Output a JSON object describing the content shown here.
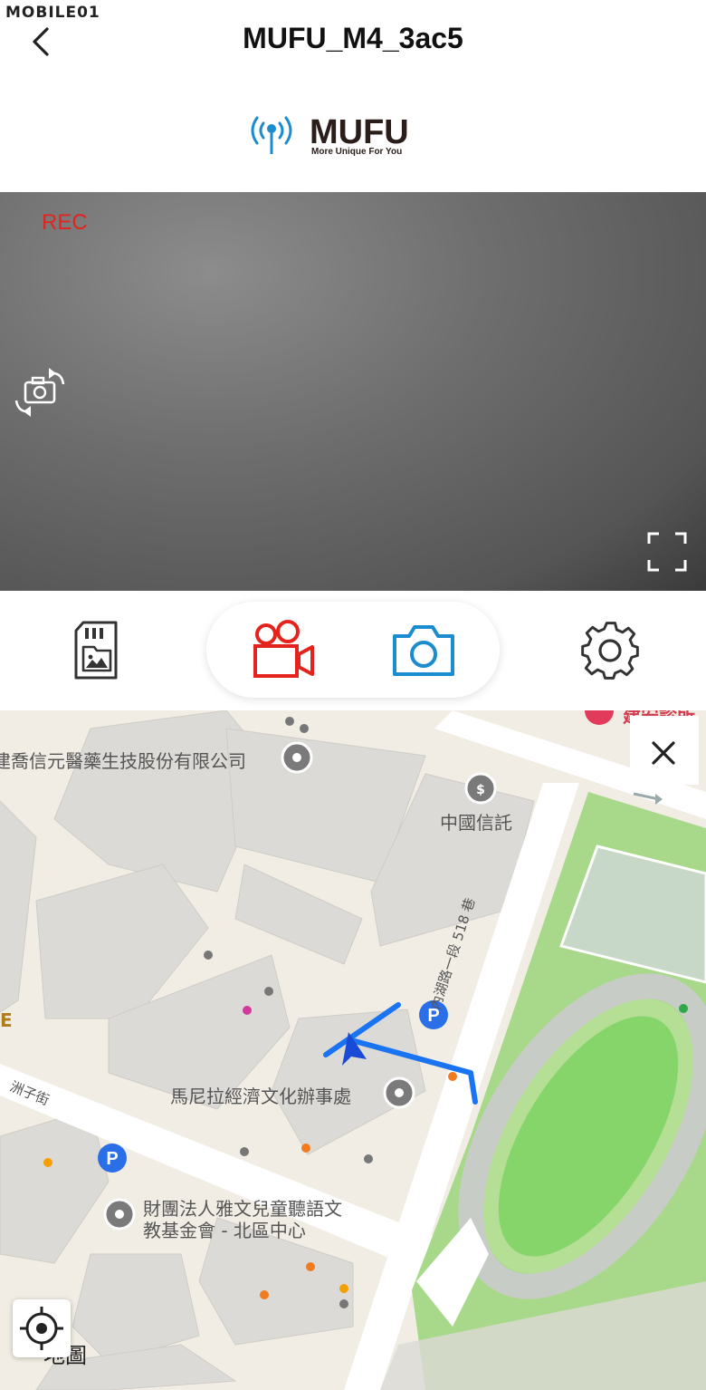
{
  "watermark": "MOBILE01",
  "header": {
    "title": "MUFU_M4_3ac5",
    "back_icon": "chevron-left-icon"
  },
  "logo": {
    "brand": "MUFU",
    "tagline": "More Unique For You",
    "brand_color": "#1a8ccf"
  },
  "camera": {
    "rec_label": "REC",
    "rec_color": "#e4231f"
  },
  "controls": {
    "sd_icon": "sd-card-gallery-icon",
    "video_icon": "video-camera-icon",
    "photo_icon": "camera-icon",
    "settings_icon": "gear-icon",
    "video_color": "#e4231f",
    "photo_color": "#1a8ccf"
  },
  "map": {
    "labels": {
      "company": "建喬信元醫藥生技股份有限公司",
      "bank": "中國信託",
      "office": "馬尼拉經濟文化辦事處",
      "foundation_line1": "財團法人雅文兒童聽語文",
      "foundation_line2": "教基金會 - 北區中心",
      "road": "內湖路一段 518 巷",
      "street": "洲子街",
      "clinic": "建安診所",
      "edge_letter": "E",
      "maps_brand": "地圖"
    },
    "route_color": "#1a73f0",
    "park_color": "#a8d98a"
  }
}
